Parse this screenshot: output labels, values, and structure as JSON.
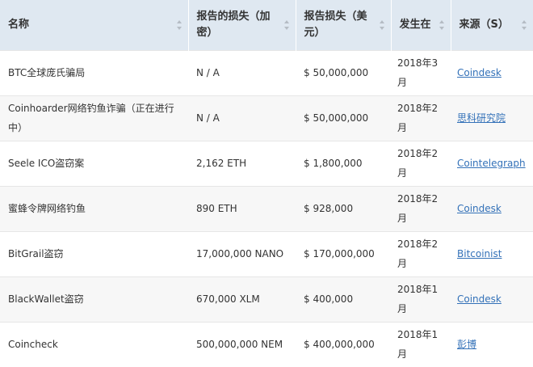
{
  "table": {
    "columns": [
      {
        "label": "名称",
        "sort_icon": "sort-arrows-icon"
      },
      {
        "label": "报告的损失（加密）",
        "sort_icon": "sort-arrows-icon"
      },
      {
        "label": "报告损失（美元）",
        "sort_icon": "sort-arrows-icon"
      },
      {
        "label": "发生在",
        "sort_icon": "sort-arrows-icon"
      },
      {
        "label": "来源（S）",
        "sort_icon": "sort-arrows-icon"
      }
    ],
    "rows": [
      {
        "name": "BTC全球庞氏骗局",
        "crypto": "N / A",
        "usd": "$ 50,000,000",
        "date": "2018年3月",
        "source": "Coindesk"
      },
      {
        "name": "Coinhoarder网络钓鱼诈骗（正在进行中）",
        "crypto": "N / A",
        "usd": "$ 50,000,000",
        "date": "2018年2月",
        "source": "思科研究院"
      },
      {
        "name": "Seele ICO盗窃案",
        "crypto": "2,162 ETH",
        "usd": "$ 1,800,000",
        "date": "2018年2月",
        "source": "Cointelegraph"
      },
      {
        "name": "蜜蜂令牌网络钓鱼",
        "crypto": "890 ETH",
        "usd": "$ 928,000",
        "date": "2018年2月",
        "source": "Coindesk"
      },
      {
        "name": "BitGrail盗窃",
        "crypto": "17,000,000 NANO",
        "usd": "$ 170,000,000",
        "date": "2018年2月",
        "source": "Bitcoinist"
      },
      {
        "name": "BlackWallet盗窃",
        "crypto": "670,000 XLM",
        "usd": "$ 400,000",
        "date": "2018年1月",
        "source": "Coindesk"
      },
      {
        "name": "Coincheck",
        "crypto": "500,000,000 NEM",
        "usd": "$ 400,000,000",
        "date": "2018年1月",
        "source": "彭博"
      }
    ]
  }
}
